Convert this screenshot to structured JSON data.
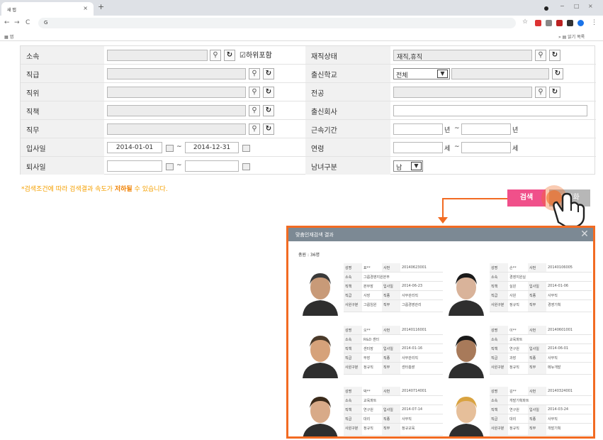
{
  "browser": {
    "tab_title": "새 탭",
    "tab_close": "×",
    "new_tab": "+",
    "url": "G",
    "bookmark_left": "앱",
    "bookmark_right": "읽기 목록",
    "back": "←",
    "forward": "→",
    "reload": "C",
    "minimize": "−",
    "maximize": "□",
    "close": "×"
  },
  "form": {
    "left_labels": [
      "소속",
      "직급",
      "직위",
      "직책",
      "직무",
      "입사일",
      "퇴사일"
    ],
    "right_labels": [
      "재직상태",
      "출신학교",
      "전공",
      "출신회사",
      "근속기간",
      "연령",
      "남녀구분"
    ],
    "include_sub_label": "하위포함",
    "employment_status_value": "재직,휴직",
    "school_select": "전체",
    "hire_from": "2014-01-01",
    "hire_to": "2014-12-31",
    "tilde": "~",
    "years_unit": "년",
    "age_unit": "세",
    "gender_select": "남"
  },
  "note": {
    "prefix": "*검색조건에 따라 검색결과 속도가 ",
    "bold": "저하될",
    "suffix": " 수 있습니다."
  },
  "buttons": {
    "search": "검색",
    "reset": "초기화"
  },
  "popup": {
    "title": "맞춤인재검색 결과",
    "total": "총원 : 36명",
    "field_labels": {
      "name": "성명",
      "id": "사번",
      "dept": "소속",
      "position": "직책",
      "hire": "입사일",
      "rank": "직급",
      "duty": "직종",
      "type": "사원구분",
      "task": "직무"
    },
    "cards": [
      {
        "name": "표**",
        "id": "20140623001",
        "dept": "그룹경영지원본부",
        "position": "본부장",
        "hire": "2014-06-23",
        "rank": "사장",
        "duty": "사무관리직",
        "type": "그룹임원",
        "task": "그룹경영관리"
      },
      {
        "name": "손**",
        "id": "20140106005",
        "dept": "경영지원실",
        "position": "실원",
        "hire": "2014-01-06",
        "rank": "사원",
        "duty": "사무직",
        "type": "정규직",
        "task": "경영기획"
      },
      {
        "name": "오**",
        "id": "20140116001",
        "dept": "R&D 센터",
        "position": "센터장",
        "hire": "2014-01-16",
        "rank": "부장",
        "duty": "사무관리직",
        "type": "정규직",
        "task": "센터총괄"
      },
      {
        "name": "이**",
        "id": "20140601001",
        "dept": "교육파트",
        "position": "연구원",
        "hire": "2014-06-01",
        "rank": "과장",
        "duty": "사무직",
        "type": "정규직",
        "task": "메뉴개발"
      },
      {
        "name": "박**",
        "id": "20140714001",
        "dept": "교육파트",
        "position": "연구원",
        "hire": "2014-07-14",
        "rank": "대리",
        "duty": "사무직",
        "type": "정규직",
        "task": "정규교육"
      },
      {
        "name": "김**",
        "id": "20140324001",
        "dept": "개발기획파트",
        "position": "연구원",
        "hire": "2014-03-24",
        "rank": "대리",
        "duty": "사무직",
        "type": "정규직",
        "task": "개발기획"
      }
    ]
  },
  "colors": {
    "accent": "#f26b22",
    "search_btn": "#f0508a",
    "note": "#f5a000",
    "popup_header": "#7c8994"
  },
  "icons": {
    "search": "magnifier-icon",
    "reset": "refresh-icon",
    "calendar": "calendar-icon",
    "cursor": "hand-pointer-icon"
  }
}
